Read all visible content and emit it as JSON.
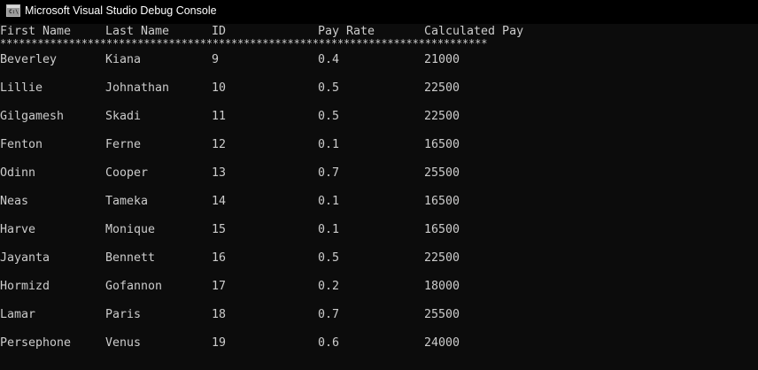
{
  "window": {
    "title": "Microsoft Visual Studio Debug Console",
    "icon": "console-app-icon",
    "icon_glyph": "C:\\"
  },
  "table": {
    "headers": [
      "First Name",
      "Last Name",
      "ID",
      "Pay Rate",
      "Calculated Pay"
    ],
    "separator": "******************************************************************************",
    "rows": [
      [
        "Beverley",
        "Kiana",
        "9",
        "0.4",
        "21000"
      ],
      [
        "Lillie",
        "Johnathan",
        "10",
        "0.5",
        "22500"
      ],
      [
        "Gilgamesh",
        "Skadi",
        "11",
        "0.5",
        "22500"
      ],
      [
        "Fenton",
        "Ferne",
        "12",
        "0.1",
        "16500"
      ],
      [
        "Odinn",
        "Cooper",
        "13",
        "0.7",
        "25500"
      ],
      [
        "Neas",
        "Tameka",
        "14",
        "0.1",
        "16500"
      ],
      [
        "Harve",
        "Monique",
        "15",
        "0.1",
        "16500"
      ],
      [
        "Jayanta",
        "Bennett",
        "16",
        "0.5",
        "22500"
      ],
      [
        "Hormizd",
        "Gofannon",
        "17",
        "0.2",
        "18000"
      ],
      [
        "Lamar",
        "Paris",
        "18",
        "0.7",
        "25500"
      ],
      [
        "Persephone",
        "Venus",
        "19",
        "0.6",
        "24000"
      ]
    ]
  },
  "colors": {
    "background": "#0c0c0c",
    "text": "#cccccc",
    "titlebar": "#000000",
    "title_text": "#ffffff"
  }
}
